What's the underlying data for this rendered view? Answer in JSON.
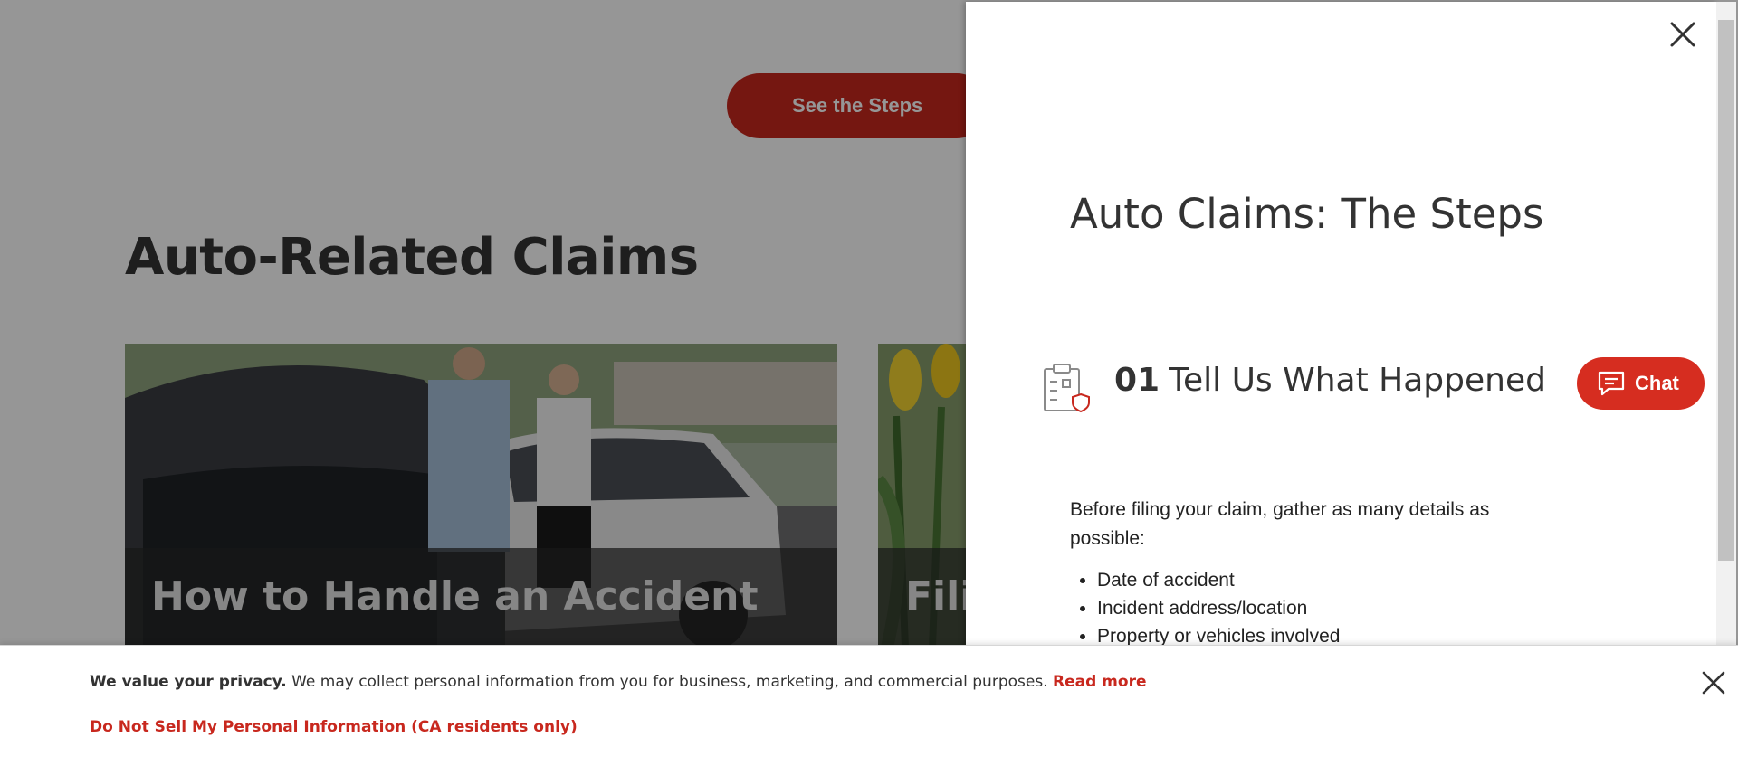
{
  "page": {
    "hero_button_label": "See the Steps",
    "section_title": "Auto-Related Claims",
    "cards": [
      {
        "title": "How to Handle an Accident"
      },
      {
        "title": "Fili"
      }
    ]
  },
  "drawer": {
    "title": "Auto Claims: The Steps",
    "close_icon": "close-icon",
    "step": {
      "number": "01",
      "heading": "Tell Us What Happened",
      "icon": "clipboard-shield-icon",
      "intro": "Before filing your claim, gather as many details as possible:",
      "items": [
        "Date of accident",
        "Incident address/location",
        "Property or vehicles involved"
      ]
    }
  },
  "chat": {
    "label": "Chat",
    "icon": "chat-bubble-icon"
  },
  "privacy": {
    "lead": "We value your privacy.",
    "text": " We may collect personal information from you for business, marketing, and commercial purposes. ",
    "read_more": "Read more",
    "do_not_sell": "Do Not Sell My Personal Information (CA residents only)",
    "close_icon": "close-icon"
  },
  "colors": {
    "brand_red": "#c8281e",
    "chat_red": "#d62d20",
    "overlay": "rgba(0,0,0,0.41)"
  }
}
